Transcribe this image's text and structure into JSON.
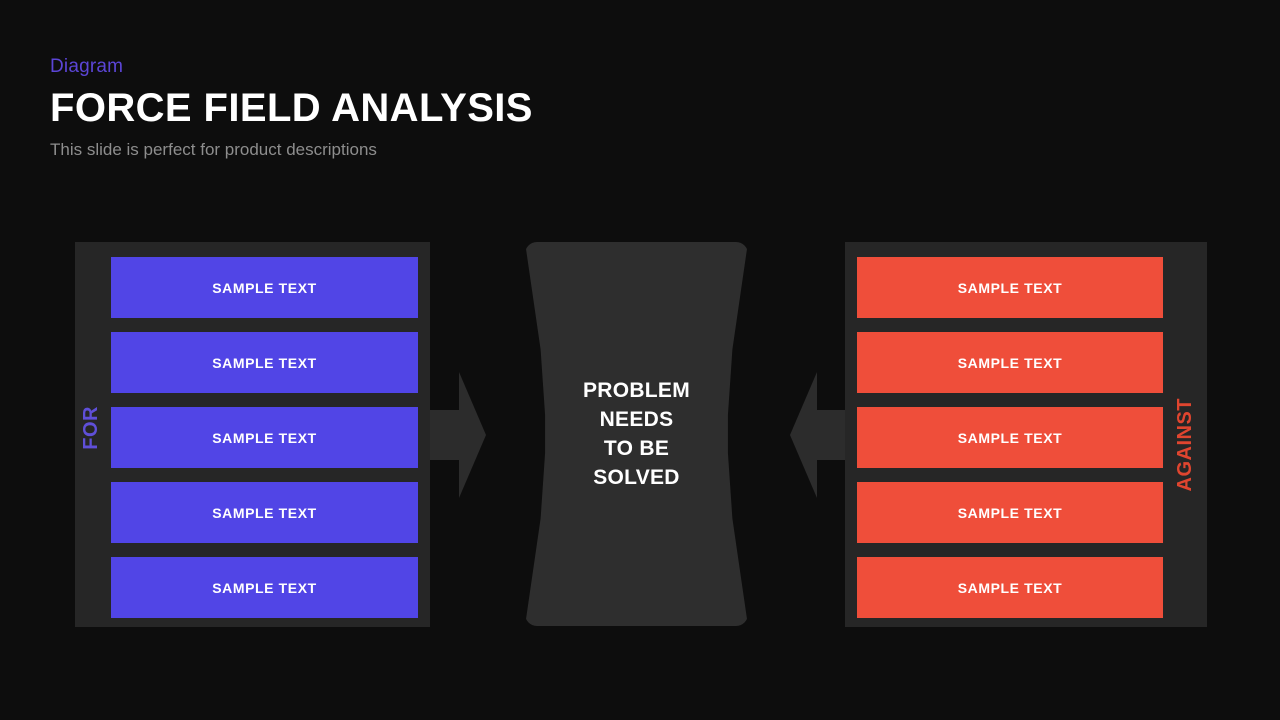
{
  "header": {
    "eyebrow": "Diagram",
    "title": "FORCE FIELD ANALYSIS",
    "subtitle": "This slide is perfect for product descriptions"
  },
  "diagram": {
    "type": "force-field-analysis",
    "center": {
      "lines": [
        "PROBLEM",
        "NEEDS",
        "TO BE",
        "SOLVED"
      ]
    },
    "driving_forces": {
      "axis_label": "FOR",
      "color": "#5145e6",
      "label_color": "#5f4fd8",
      "items": [
        {
          "label": "SAMPLE TEXT"
        },
        {
          "label": "SAMPLE TEXT"
        },
        {
          "label": "SAMPLE TEXT"
        },
        {
          "label": "SAMPLE TEXT"
        },
        {
          "label": "SAMPLE TEXT"
        }
      ]
    },
    "restraining_forces": {
      "axis_label": "AGAINST",
      "color": "#ef4e3a",
      "label_color": "#e0452f",
      "items": [
        {
          "label": "SAMPLE TEXT"
        },
        {
          "label": "SAMPLE TEXT"
        },
        {
          "label": "SAMPLE TEXT"
        },
        {
          "label": "SAMPLE TEXT"
        },
        {
          "label": "SAMPLE TEXT"
        }
      ]
    },
    "arrows": [
      {
        "name": "arrow-right",
        "direction": "right",
        "color": "#2c2c2c"
      },
      {
        "name": "arrow-left",
        "direction": "left",
        "color": "#2c2c2c"
      }
    ],
    "colors": {
      "background": "#0d0d0d",
      "panel": "#262626",
      "center_shape": "#2e2e2e",
      "eyebrow": "#5b45d6",
      "title": "#ffffff",
      "subtitle": "#8d8d8d"
    }
  }
}
